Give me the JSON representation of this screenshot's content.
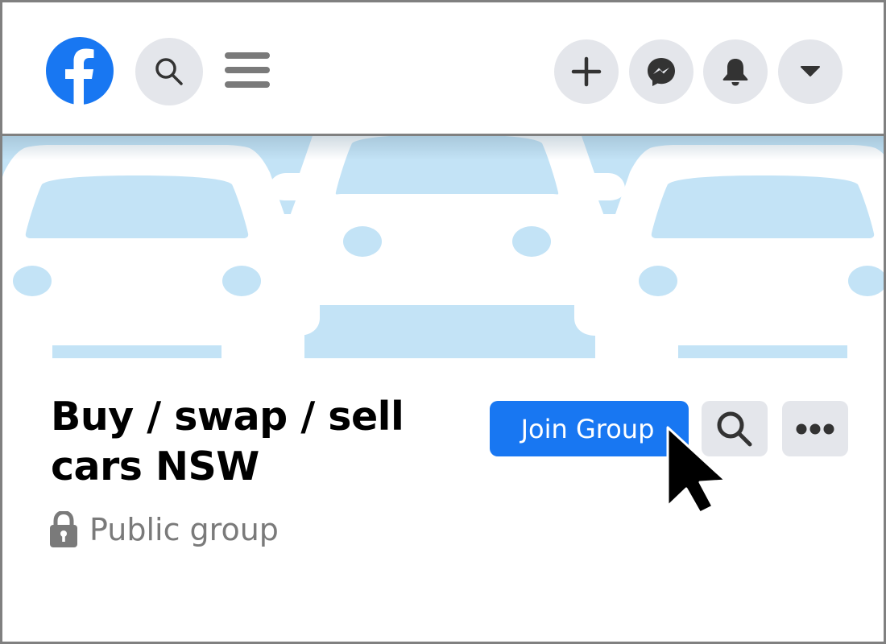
{
  "app": {
    "name": "Facebook",
    "brand_color": "#1877f2"
  },
  "topbar": {
    "logo_icon": "facebook-logo-icon",
    "search_icon": "search-icon",
    "menu_icon": "hamburger-menu-icon",
    "actions": [
      {
        "name": "create",
        "icon": "plus-icon"
      },
      {
        "name": "messenger",
        "icon": "messenger-icon"
      },
      {
        "name": "notifications",
        "icon": "bell-icon"
      },
      {
        "name": "account",
        "icon": "caret-down-icon"
      }
    ]
  },
  "cover": {
    "image": "three-cars-illustration",
    "background_color": "#c3e3f6"
  },
  "group": {
    "name": "Buy / swap / sell cars NSW",
    "privacy_icon": "lock-icon",
    "privacy": "Public group",
    "join_label": "Join Group",
    "search_icon": "search-icon",
    "more_icon": "more-dots-icon"
  },
  "pointer": {
    "icon": "mouse-cursor-icon"
  }
}
